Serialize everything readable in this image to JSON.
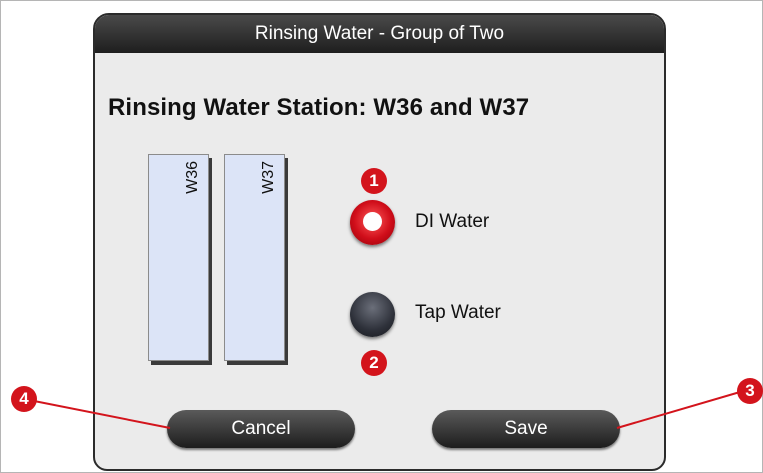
{
  "dialog": {
    "title": "Rinsing Water - Group of Two",
    "station_heading": "Rinsing Water Station: W36 and W37"
  },
  "containers": [
    {
      "label": "W36"
    },
    {
      "label": "W37"
    }
  ],
  "options": [
    {
      "label": "DI Water",
      "selected": true
    },
    {
      "label": "Tap Water",
      "selected": false
    }
  ],
  "buttons": {
    "cancel": "Cancel",
    "save": "Save"
  },
  "callouts": {
    "di_water": "1",
    "tap_water": "2",
    "save": "3",
    "cancel": "4"
  },
  "colors": {
    "accent": "#d3141c",
    "title_bar": "#2b2b2b",
    "container_fill": "#dce4f7"
  }
}
